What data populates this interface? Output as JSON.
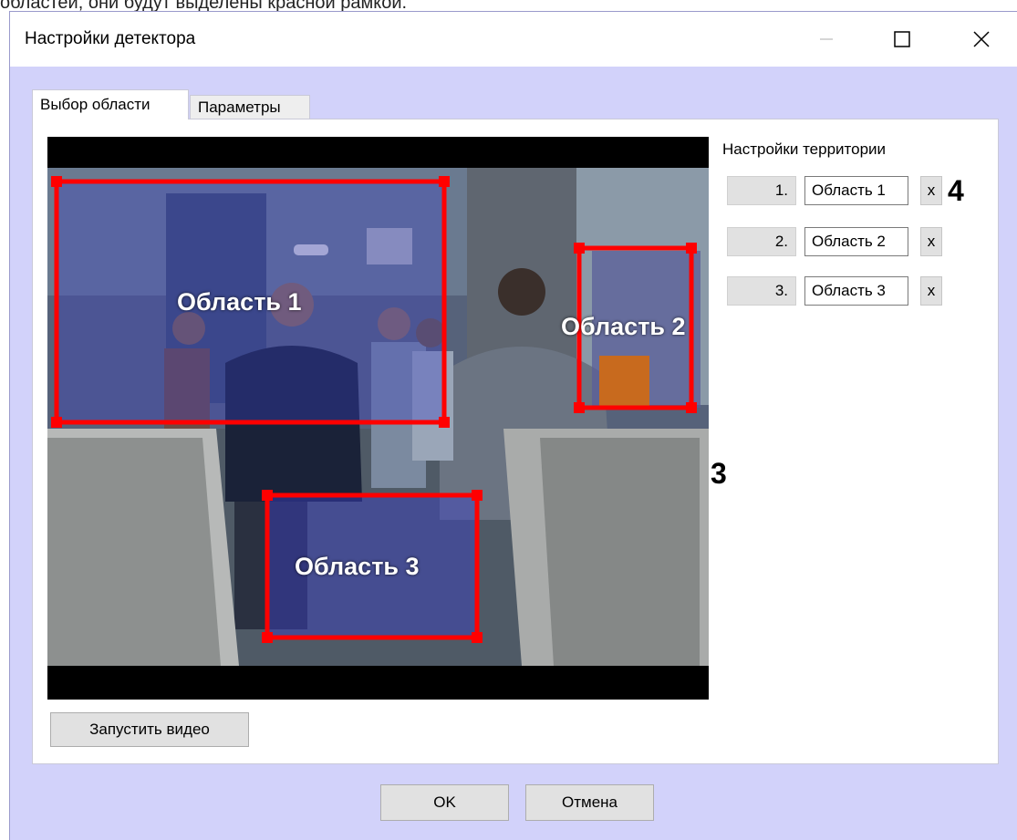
{
  "doc_caption": "областей, они будут выделены красной рамкой.",
  "window": {
    "title": "Настройки детектора"
  },
  "tabs": [
    {
      "label": "Выбор области",
      "active": true
    },
    {
      "label": "Параметры",
      "active": false
    }
  ],
  "video": {
    "regions": [
      {
        "label": "Область 1"
      },
      {
        "label": "Область 2"
      },
      {
        "label": "Область 3"
      }
    ],
    "start_button": "Запустить видео"
  },
  "territory": {
    "title": "Настройки территории",
    "rows": [
      {
        "num": "1.",
        "name": "Область 1",
        "delete": "x"
      },
      {
        "num": "2.",
        "name": "Область 2",
        "delete": "x"
      },
      {
        "num": "3.",
        "name": "Область 3",
        "delete": "x"
      }
    ]
  },
  "callouts": {
    "c3": "3",
    "c4": "4"
  },
  "footer": {
    "ok": "OK",
    "cancel": "Отмена"
  },
  "colors": {
    "dialog_bg": "#d2d2fa",
    "region_border": "#ff0000"
  }
}
